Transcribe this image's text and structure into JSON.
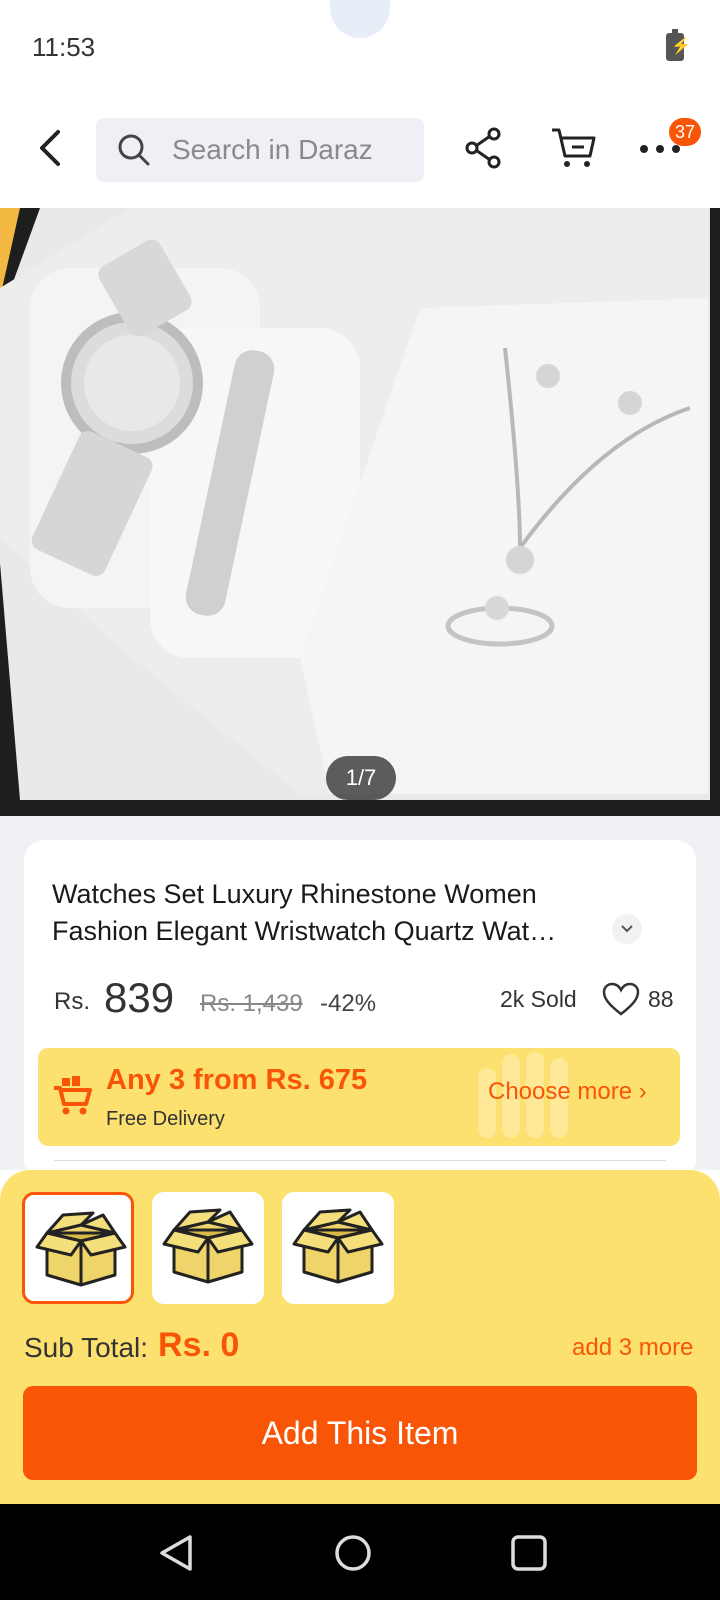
{
  "status_bar": {
    "time": "11:53"
  },
  "header": {
    "search_placeholder": "Search in Daraz",
    "cart_badge": "37"
  },
  "gallery": {
    "counter": "1/7"
  },
  "product": {
    "title": "Watches Set Luxury Rhinestone Women Fashion Elegant Wristwatch Quartz Wat…",
    "currency": "Rs.",
    "price": "839",
    "original_price": "Rs. 1,439",
    "discount": "-42%",
    "sold": "2k Sold",
    "likes": "88"
  },
  "promo": {
    "headline": "Any 3 from Rs. 675",
    "subline": "Free Delivery",
    "action": "Choose more"
  },
  "bundle": {
    "slots": [
      {
        "selected": true
      },
      {
        "selected": false
      },
      {
        "selected": false
      }
    ],
    "subtotal_label": "Sub Total:",
    "subtotal_value": "Rs. 0",
    "add_more": "add 3 more",
    "add_button": "Add This Item"
  },
  "colors": {
    "accent": "#f85606",
    "promo_bg": "#fde170"
  }
}
